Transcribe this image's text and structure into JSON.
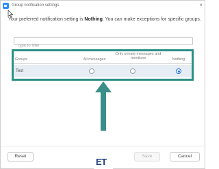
{
  "window": {
    "title": "Group notification settings",
    "close_glyph": "×"
  },
  "info": {
    "prefix": "Your preferred notification setting is ",
    "setting": "Nothing",
    "suffix": ". You can make exceptions for specific groups."
  },
  "filter": {
    "placeholder": "Type to filter",
    "value": ""
  },
  "table": {
    "columns": {
      "groups": "Groups",
      "all_messages": "All messages",
      "private_mentions": "Only private messages and mentions",
      "nothing": "Nothing"
    },
    "rows": [
      {
        "name": "Test",
        "selected": "nothing"
      }
    ]
  },
  "buttons": {
    "reset": "Reset",
    "save": "Save",
    "cancel": "Cancel"
  },
  "logo": "ET",
  "colors": {
    "highlight_border": "#2a8f86",
    "arrow": "#3a8f88",
    "radio_selected": "#1a73e8",
    "row_background": "#e6edf4",
    "logo": "#1f3f7a"
  },
  "icons": {
    "app": "zoom-app-icon",
    "close": "close-icon",
    "cursor": "mouse-cursor-icon",
    "annotation": "up-arrow-icon"
  }
}
